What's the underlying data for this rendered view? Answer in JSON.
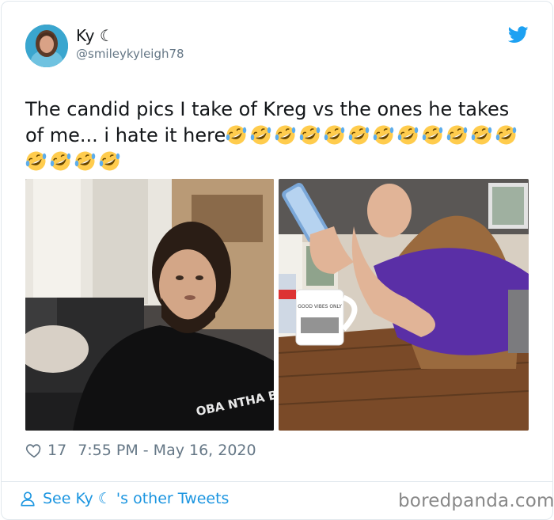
{
  "tweet": {
    "display_name": "Ky ☾",
    "handle": "@smileykyleigh78",
    "text": "The candid pics I take of Kreg vs the ones he takes of me... i hate it here",
    "emoji_name": "rolling-on-floor-laughing-emoji",
    "emoji_count": 16,
    "likes": "17",
    "timestamp": "7:55 PM - May 16, 2020",
    "see_more": "See Ky ☾ 's other Tweets",
    "shirt_print": "OBA NTHA BEA S",
    "mug_print": "GOOD VIBES ONLY"
  },
  "watermark": "boredpanda.com",
  "colors": {
    "twitter_blue": "#1da1f2",
    "link_blue": "#1b95e0",
    "meta_gray": "#657786",
    "border": "#e1e8ed"
  },
  "icons": [
    "twitter-bird-icon",
    "heart-icon",
    "person-icon"
  ]
}
